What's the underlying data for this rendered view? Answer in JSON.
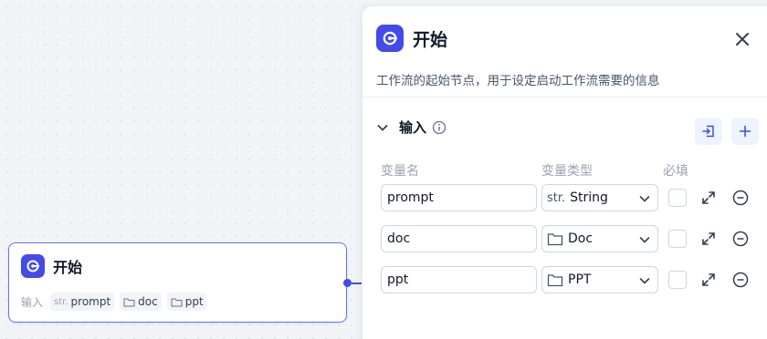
{
  "node": {
    "title": "开始",
    "inputs_label": "输入",
    "chips": [
      {
        "prefix": "str.",
        "label": "prompt",
        "icon": "text-type-icon"
      },
      {
        "prefix": "",
        "label": "doc",
        "icon": "folder-icon"
      },
      {
        "prefix": "",
        "label": "ppt",
        "icon": "folder-icon"
      }
    ]
  },
  "panel": {
    "title": "开始",
    "description": "工作流的起始节点，用于设定启动工作流需要的信息",
    "section_title": "输入",
    "columns": {
      "name": "变量名",
      "type": "变量类型",
      "required": "必填"
    },
    "rows": [
      {
        "name": "prompt",
        "type_prefix": "str.",
        "type": "String",
        "type_icon": "text-type-icon",
        "required": false
      },
      {
        "name": "doc",
        "type_prefix": "",
        "type": "Doc",
        "type_icon": "folder-icon",
        "required": false
      },
      {
        "name": "ppt",
        "type_prefix": "",
        "type": "PPT",
        "type_icon": "folder-icon",
        "required": false
      }
    ]
  },
  "colors": {
    "accent": "#444ce7",
    "node_border": "#6172f3",
    "button_bg": "#eef4ff"
  }
}
